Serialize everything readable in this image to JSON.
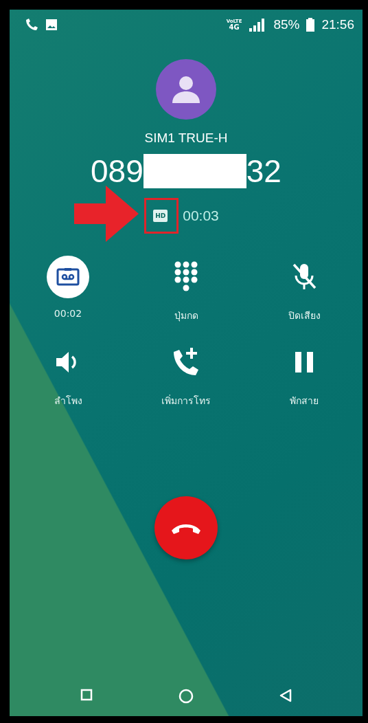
{
  "status_bar": {
    "network_top": "VoLTE",
    "network_bottom": "4G",
    "battery": "85%",
    "time": "21:56"
  },
  "caller": {
    "line": "SIM1 TRUE-H",
    "number_start": "089",
    "number_end": "32"
  },
  "call_info": {
    "hd": "HD",
    "duration": "00:03"
  },
  "controls": [
    {
      "kind": "record",
      "label": "00:02",
      "selected": true
    },
    {
      "kind": "keypad",
      "label": "ปุ่มกด",
      "selected": false
    },
    {
      "kind": "mute",
      "label": "ปิดเสียง",
      "selected": false
    },
    {
      "kind": "speaker",
      "label": "ลำโพง",
      "selected": false
    },
    {
      "kind": "add_call",
      "label": "เพิ่มการโทร",
      "selected": false
    },
    {
      "kind": "hold",
      "label": "พักสาย",
      "selected": false
    }
  ]
}
